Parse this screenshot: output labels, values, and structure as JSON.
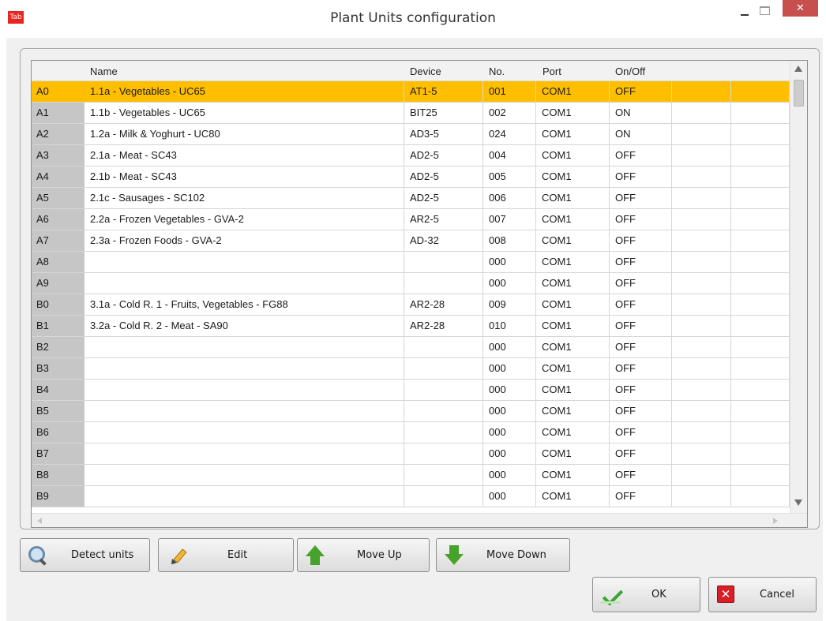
{
  "window": {
    "app_icon_text": "Tab",
    "title": "Plant Units configuration",
    "close_glyph": "✕"
  },
  "grid": {
    "columns": [
      "Name",
      "Device",
      "No.",
      "Port",
      "On/Off"
    ],
    "selected_row": 0,
    "rows": [
      {
        "id": "A0",
        "name": "1.1a - Vegetables - UC65",
        "device": "AT1-5",
        "no": "001",
        "port": "COM1",
        "onoff": "OFF"
      },
      {
        "id": "A1",
        "name": "1.1b - Vegetables - UC65",
        "device": "BIT25",
        "no": "002",
        "port": "COM1",
        "onoff": "ON"
      },
      {
        "id": "A2",
        "name": "1.2a - Milk & Yoghurt - UC80",
        "device": "AD3-5",
        "no": "024",
        "port": "COM1",
        "onoff": "ON"
      },
      {
        "id": "A3",
        "name": "2.1a - Meat - SC43",
        "device": "AD2-5",
        "no": "004",
        "port": "COM1",
        "onoff": "OFF"
      },
      {
        "id": "A4",
        "name": "2.1b - Meat - SC43",
        "device": "AD2-5",
        "no": "005",
        "port": "COM1",
        "onoff": "OFF"
      },
      {
        "id": "A5",
        "name": "2.1c - Sausages - SC102",
        "device": "AD2-5",
        "no": "006",
        "port": "COM1",
        "onoff": "OFF"
      },
      {
        "id": "A6",
        "name": "2.2a - Frozen Vegetables - GVA-2",
        "device": "AR2-5",
        "no": "007",
        "port": "COM1",
        "onoff": "OFF"
      },
      {
        "id": "A7",
        "name": "2.3a - Frozen Foods - GVA-2",
        "device": "AD-32",
        "no": "008",
        "port": "COM1",
        "onoff": "OFF"
      },
      {
        "id": "A8",
        "name": "",
        "device": "",
        "no": "000",
        "port": "COM1",
        "onoff": "OFF"
      },
      {
        "id": "A9",
        "name": "",
        "device": "",
        "no": "000",
        "port": "COM1",
        "onoff": "OFF"
      },
      {
        "id": "B0",
        "name": "3.1a - Cold R. 1 - Fruits, Vegetables - FG88",
        "device": "AR2-28",
        "no": "009",
        "port": "COM1",
        "onoff": "OFF"
      },
      {
        "id": "B1",
        "name": "3.2a - Cold R. 2 - Meat - SA90",
        "device": "AR2-28",
        "no": "010",
        "port": "COM1",
        "onoff": "OFF"
      },
      {
        "id": "B2",
        "name": "",
        "device": "",
        "no": "000",
        "port": "COM1",
        "onoff": "OFF"
      },
      {
        "id": "B3",
        "name": "",
        "device": "",
        "no": "000",
        "port": "COM1",
        "onoff": "OFF"
      },
      {
        "id": "B4",
        "name": "",
        "device": "",
        "no": "000",
        "port": "COM1",
        "onoff": "OFF"
      },
      {
        "id": "B5",
        "name": "",
        "device": "",
        "no": "000",
        "port": "COM1",
        "onoff": "OFF"
      },
      {
        "id": "B6",
        "name": "",
        "device": "",
        "no": "000",
        "port": "COM1",
        "onoff": "OFF"
      },
      {
        "id": "B7",
        "name": "",
        "device": "",
        "no": "000",
        "port": "COM1",
        "onoff": "OFF"
      },
      {
        "id": "B8",
        "name": "",
        "device": "",
        "no": "000",
        "port": "COM1",
        "onoff": "OFF"
      },
      {
        "id": "B9",
        "name": "",
        "device": "",
        "no": "000",
        "port": "COM1",
        "onoff": "OFF"
      }
    ]
  },
  "toolbar": {
    "detect_label": "Detect units",
    "edit_label": "Edit",
    "move_up_label": "Move Up",
    "move_down_label": "Move Down"
  },
  "dialog": {
    "ok_label": "OK",
    "cancel_label": "Cancel",
    "cancel_icon_glyph": "✕"
  },
  "icons": {
    "detect": "magnifier-icon",
    "edit": "pencil-icon",
    "move_up": "arrow-up-icon",
    "move_down": "arrow-down-icon",
    "ok": "checkmark-icon",
    "cancel": "close-icon"
  },
  "colors": {
    "selection": "#ffbf00",
    "row_header": "#c6c6c6",
    "window_background": "#f0f0f0",
    "close_button": "#c7504f",
    "arrow_green": "#46a22a",
    "cancel_red": "#d81f26"
  }
}
